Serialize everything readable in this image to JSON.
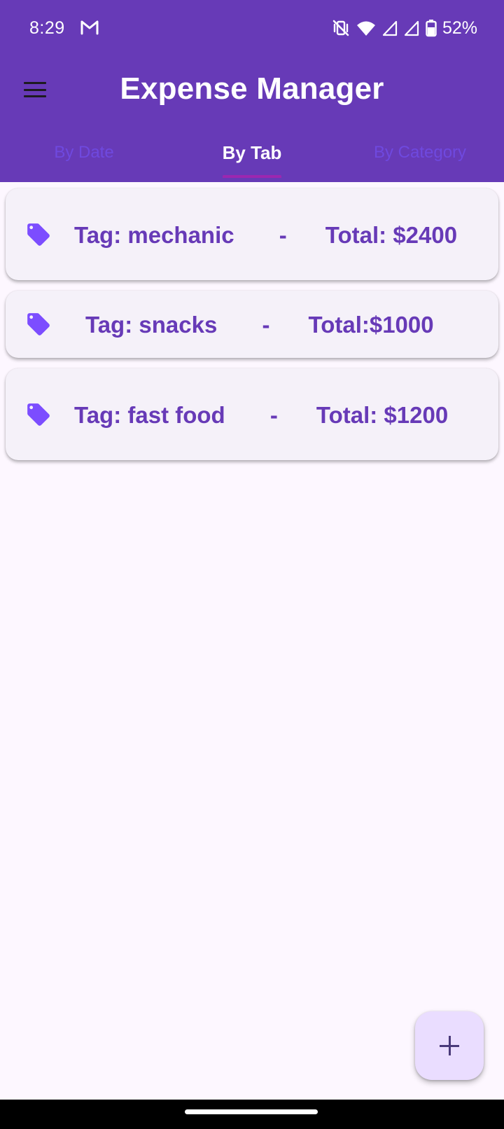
{
  "status_bar": {
    "time": "8:29",
    "battery": "52%",
    "icons": [
      "gmail-icon",
      "vibrate-off-icon",
      "wifi-icon",
      "signal-icon",
      "signal-icon",
      "battery-icon"
    ]
  },
  "app_bar": {
    "title": "Expense Manager",
    "menu_icon": "hamburger-menu-icon",
    "background": "#673ab7"
  },
  "tabs": [
    {
      "label": "By Date",
      "active": false
    },
    {
      "label": "By Tab",
      "active": true
    },
    {
      "label": "By Category",
      "active": false
    }
  ],
  "tag_list": [
    {
      "label": "Tag: mechanic       -      Total: $2400",
      "icon": "tag-icon"
    },
    {
      "label": "Tag: snacks       -      Total:$1000",
      "icon": "tag-icon"
    },
    {
      "label": "Tag: fast food       -      Total: $1200",
      "icon": "tag-icon"
    }
  ],
  "fab": {
    "icon": "plus-icon"
  },
  "colors": {
    "primary": "#673ab7",
    "tab_inactive": "#6f49df",
    "tab_indicator": "#9c27b0",
    "card_bg": "#f5f1f9",
    "icon": "#7c4dff",
    "fab_bg": "#eaddff",
    "page_bg": "#fdf7ff"
  }
}
